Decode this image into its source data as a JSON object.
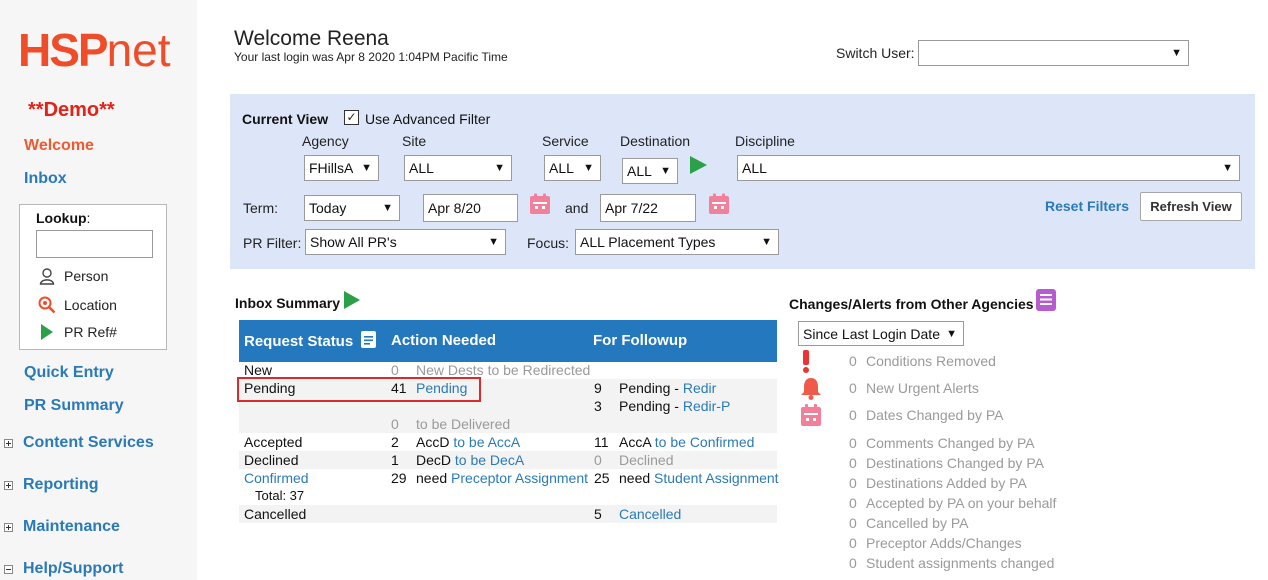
{
  "brand": {
    "logo_main": "HSP",
    "logo_suffix": "net",
    "demo_label": "**Demo**"
  },
  "sidebar": {
    "welcome": "Welcome",
    "inbox": "Inbox",
    "lookup": {
      "label": "Lookup",
      "colon": ":",
      "value": "",
      "items": [
        "Person",
        "Location",
        "PR Ref#"
      ]
    },
    "quick_entry": "Quick Entry",
    "pr_summary": "PR Summary",
    "groups": [
      "Content Services",
      "Reporting",
      "Maintenance",
      "Help/Support"
    ]
  },
  "header": {
    "welcome": "Welcome Reena",
    "last_login": "Your last login was Apr 8 2020 1:04PM Pacific Time",
    "switch_user_label": "Switch User:",
    "switch_user_value": ""
  },
  "filter": {
    "current_view": "Current View",
    "use_advanced": "Use Advanced Filter",
    "use_advanced_checked": "✓",
    "agency_label": "Agency",
    "agency_value": "FHillsA",
    "site_label": "Site",
    "site_value": "ALL",
    "service_label": "Service",
    "service_value": "ALL",
    "destination_label": "Destination",
    "destination_value": "ALL",
    "discipline_label": "Discipline",
    "discipline_value": "ALL",
    "term_label": "Term:",
    "term_value": "Today",
    "date_from": "Apr 8/20",
    "and_label": "and",
    "date_to": "Apr 7/22",
    "reset": "Reset Filters",
    "refresh": "Refresh View",
    "pr_filter_label": "PR Filter:",
    "pr_filter_value": "Show All PR's",
    "focus_label": "Focus:",
    "focus_value": "ALL Placement Types"
  },
  "inbox": {
    "title": "Inbox Summary",
    "headers": {
      "status": "Request Status",
      "action": "Action Needed",
      "followup": "For Followup"
    },
    "rows": {
      "new": {
        "status": "New",
        "a_num": "0",
        "a_text": "New Dests to be Redirected"
      },
      "pending": {
        "status": "Pending",
        "a_num": "41",
        "a_link": "Pending",
        "f1_num": "9",
        "f1_text": "Pending - ",
        "f1_link": "Redir",
        "f2_num": "3",
        "f2_text": "Pending - ",
        "f2_link": "Redir-P",
        "d_num": "0",
        "d_text": "to be Delivered"
      },
      "accepted": {
        "status": "Accepted",
        "a_num": "2",
        "a_pre": "AccD ",
        "a_link": "to be AccA",
        "f_num": "11",
        "f_pre": "AccA ",
        "f_link": "to be Confirmed"
      },
      "declined": {
        "status": "Declined",
        "a_num": "1",
        "a_pre": "DecD ",
        "a_link": "to be DecA",
        "f_num": "0",
        "f_text": "Declined"
      },
      "confirmed": {
        "status": "Confirmed",
        "total": "Total: 37",
        "a_num": "29",
        "a_pre": "need ",
        "a_link": "Preceptor Assignment",
        "f_num": "25",
        "f_pre": "need ",
        "f_link": "Student Assignment"
      },
      "cancelled": {
        "status": "Cancelled",
        "f_num": "5",
        "f_link": "Cancelled"
      }
    }
  },
  "alerts": {
    "title": "Changes/Alerts from Other Agencies",
    "since": "Since Last Login Date",
    "items": [
      {
        "n": "0",
        "label": "Conditions Removed"
      },
      {
        "n": "0",
        "label": "New Urgent Alerts"
      },
      {
        "n": "0",
        "label": "Dates Changed by PA"
      },
      {
        "n": "0",
        "label": "Comments Changed by PA"
      },
      {
        "n": "0",
        "label": "Destinations Changed by PA"
      },
      {
        "n": "0",
        "label": "Destinations Added by PA"
      },
      {
        "n": "0",
        "label": "Accepted by PA on your behalf"
      },
      {
        "n": "0",
        "label": "Cancelled by PA"
      },
      {
        "n": "0",
        "label": "Preceptor Adds/Changes"
      },
      {
        "n": "0",
        "label": "Student assignments changed"
      }
    ]
  },
  "colors": {
    "brand_orange": "#ef4c2a",
    "link_blue": "#2a7ab8",
    "header_blue": "#2478bd",
    "go_green": "#2aa148",
    "filter_bg": "#dde6f8",
    "highlight_red": "#d92b2b"
  },
  "icons": [
    "person-icon",
    "location-search-icon",
    "go-arrow-icon",
    "calendar-icon",
    "notes-icon",
    "book-icon",
    "exclamation-icon",
    "bell-icon"
  ]
}
